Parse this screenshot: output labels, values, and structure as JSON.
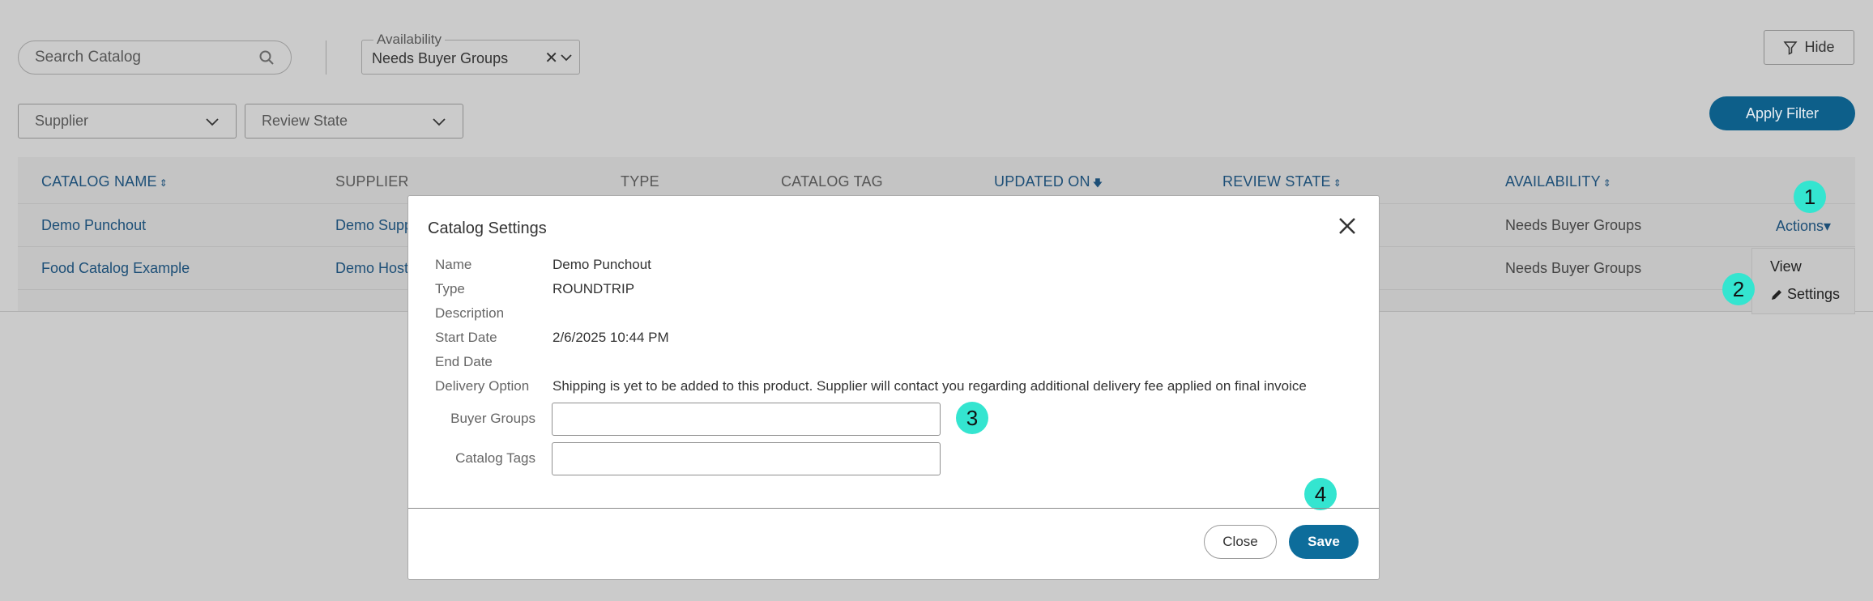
{
  "filters": {
    "search_placeholder": "Search Catalog",
    "availability_legend": "Availability",
    "availability_value": "Needs Buyer Groups",
    "clear_glyph": "✕",
    "hide_label": "Hide",
    "supplier_label": "Supplier",
    "review_state_label": "Review State",
    "apply_label": "Apply Filter"
  },
  "table": {
    "headers": {
      "catalog_name": "CATALOG NAME",
      "supplier": "SUPPLIER",
      "type": "TYPE",
      "catalog_tag": "CATALOG TAG",
      "updated_on": "UPDATED ON",
      "review_state": "REVIEW STATE",
      "availability": "AVAILABILITY"
    },
    "sort_glyphs": {
      "both": "⇕",
      "desc": "🡇"
    },
    "rows": [
      {
        "catalog_name": "Demo Punchout",
        "supplier": "Demo Supp",
        "availability": "Needs Buyer Groups"
      },
      {
        "catalog_name": "Food Catalog Example",
        "supplier": "Demo Hoste",
        "availability": "Needs Buyer Groups"
      }
    ],
    "actions_label": "Actions",
    "actions_caret": "▾"
  },
  "actions_menu": {
    "view_label": "View",
    "settings_label": "Settings"
  },
  "badges": [
    "1",
    "2",
    "3",
    "4"
  ],
  "modal": {
    "title": "Catalog Settings",
    "fields": {
      "name_label": "Name",
      "name_value": "Demo Punchout",
      "type_label": "Type",
      "type_value": "ROUNDTRIP",
      "description_label": "Description",
      "description_value": "",
      "start_date_label": "Start Date",
      "start_date_value": "2/6/2025 10:44 PM",
      "end_date_label": "End Date",
      "end_date_value": "",
      "delivery_label": "Delivery Option",
      "delivery_value": "Shipping is yet to be added to this product. Supplier will contact you regarding additional delivery fee applied on final invoice",
      "buyer_groups_label": "Buyer Groups",
      "buyer_groups_value": "",
      "catalog_tags_label": "Catalog Tags",
      "catalog_tags_value": ""
    },
    "close_label": "Close",
    "save_label": "Save"
  },
  "colors": {
    "overlay": "#cbcbcb",
    "primary": "#0d6d9b",
    "link": "#1d4f77",
    "badge": "#34e5d0"
  },
  "icons": [
    "search-icon",
    "chevron-down-icon",
    "filter-icon",
    "pencil-icon",
    "close-icon"
  ]
}
